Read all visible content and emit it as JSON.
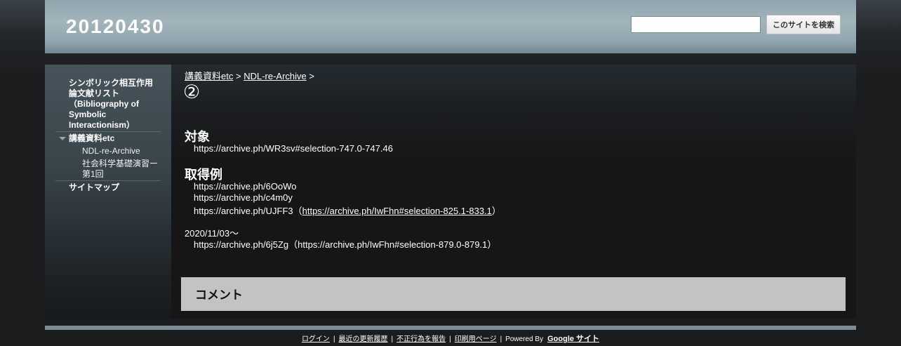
{
  "header": {
    "site_title": "20120430",
    "search_placeholder": "",
    "search_button": "このサイトを検索"
  },
  "sidebar": {
    "items": [
      {
        "label": "シンボリック相互作用論文献リスト（Bibliography of Symbolic Interactionism）"
      },
      {
        "label": "講義資料etc"
      },
      {
        "label": "NDL-re-Archive"
      },
      {
        "label": "社会科学基礎演習ー第1回"
      },
      {
        "label": "サイトマップ"
      }
    ],
    "item0_lines": [
      "シンボリック相互作用",
      "論文献リスト",
      "（Bibliography of",
      "Symbolic",
      "Interactionism）"
    ],
    "item3_lines": [
      "社会科学基礎演習ー",
      "第1回"
    ]
  },
  "breadcrumb": {
    "link1": "講義資料etc",
    "sep": ">",
    "link2": "NDL-re-Archive",
    "trail": ">"
  },
  "page": {
    "title": "②",
    "section1": {
      "heading": "対象",
      "line1": "https://archive.ph/WR3sv#selection-747.0-747.46"
    },
    "section2": {
      "heading": "取得例",
      "line1": "https://archive.ph/6OoWo",
      "line2": "https://archive.ph/c4m0y",
      "line3_prefix": "https://archive.ph/UJFF3（",
      "line3_link": "https://archive.ph/IwFhn#selection-825.1-833.1",
      "line3_suffix": "）",
      "date": "2020/11/03～",
      "line4": "https://archive.ph/6j5Zg（https://archive.ph/IwFhn#selection-879.0-879.1）"
    }
  },
  "comments": {
    "title": "コメント"
  },
  "footer": {
    "login": "ログイン",
    "recent": "最近の更新履歴",
    "report": "不正行為を報告",
    "print": "印刷用ページ",
    "powered": "Powered By",
    "google": "Google サイト",
    "divider": "|"
  }
}
